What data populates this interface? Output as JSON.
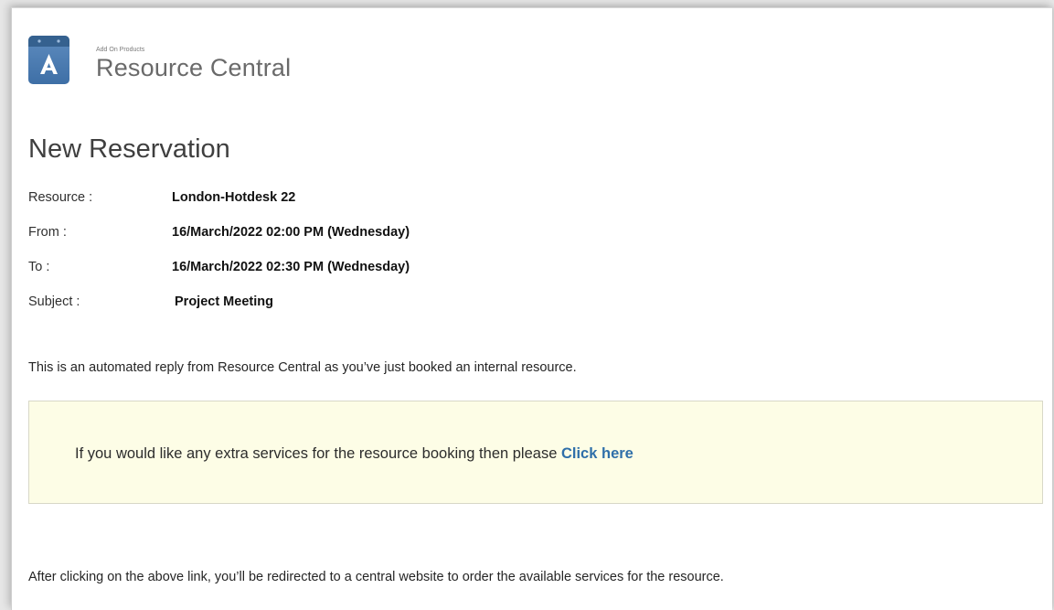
{
  "brand": {
    "small_label": "Add On Products",
    "name": "Resource Central",
    "logo_icon": "resource-central-logo-icon",
    "logo_color": "#4a7bb0"
  },
  "heading": "New Reservation",
  "details": [
    {
      "label": "Resource :",
      "value": "London-Hotdesk 22"
    },
    {
      "label": "From :",
      "value": "16/March/2022 02:00 PM (Wednesday)"
    },
    {
      "label": "To :",
      "value": "16/March/2022 02:30 PM (Wednesday)"
    },
    {
      "label": "Subject :",
      "value": "Project Meeting"
    }
  ],
  "intro_text": "This is an automated reply from Resource Central as you’ve just booked an internal resource.",
  "callout": {
    "text": "If you would like any extra services for the resource booking then please ",
    "link_label": "Click here",
    "background": "#fdfde6",
    "link_color": "#2f6fa9"
  },
  "footer_text": "After clicking on the above link, you’ll be redirected to a central website to order the available services for the resource."
}
